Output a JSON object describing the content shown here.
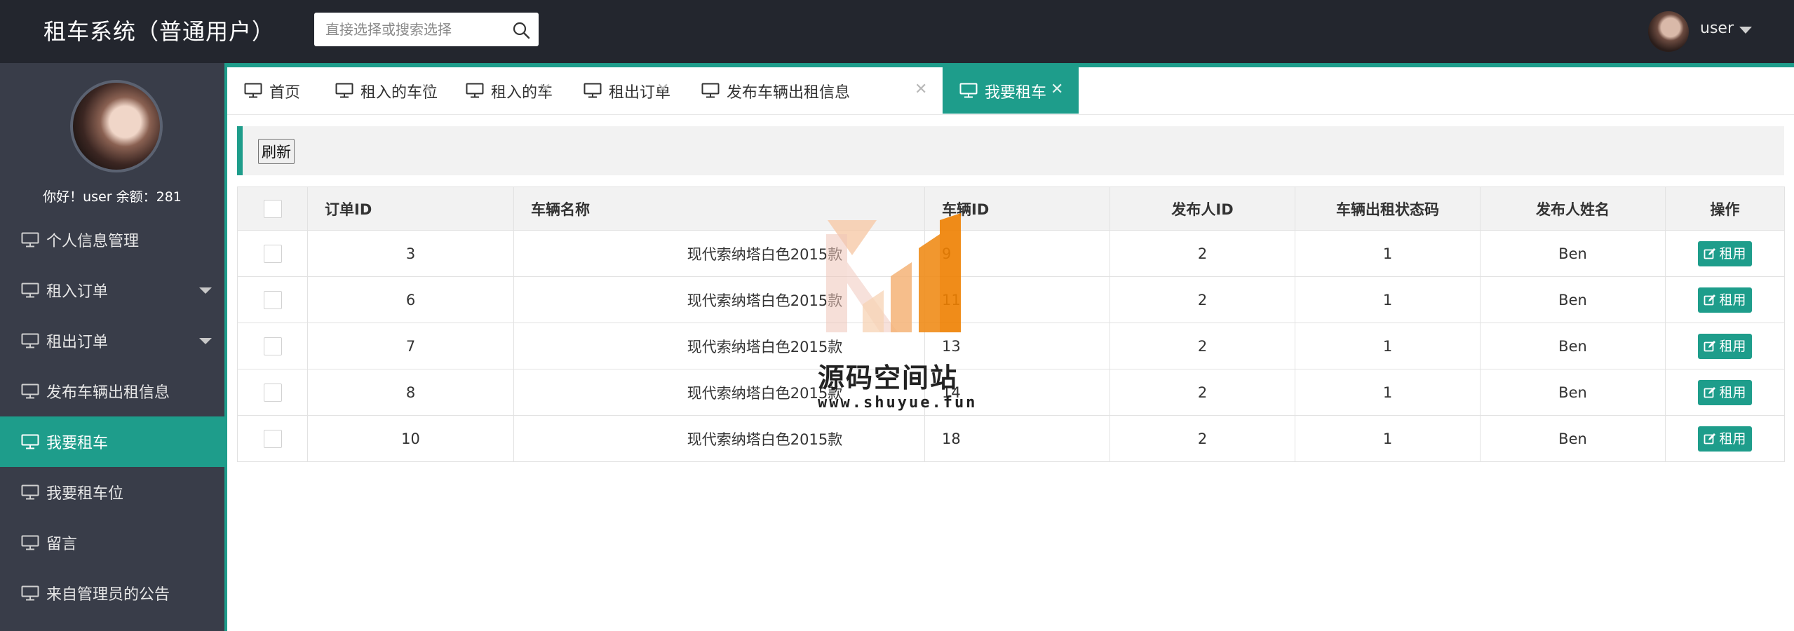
{
  "header": {
    "title": "租车系统（普通用户）",
    "search_placeholder": "直接选择或搜索选择",
    "search_icon": "search-icon",
    "username": "user"
  },
  "sidebar": {
    "greeting": "你好！user 余额：281",
    "items": [
      {
        "label": "个人信息管理",
        "icon": "monitor-icon",
        "expandable": false,
        "active": false
      },
      {
        "label": "租入订单",
        "icon": "monitor-icon",
        "expandable": true,
        "active": false
      },
      {
        "label": "租出订单",
        "icon": "monitor-icon",
        "expandable": true,
        "active": false
      },
      {
        "label": "发布车辆出租信息",
        "icon": "monitor-icon",
        "expandable": false,
        "active": false
      },
      {
        "label": "我要租车",
        "icon": "monitor-icon",
        "expandable": false,
        "active": true
      },
      {
        "label": "我要租车位",
        "icon": "monitor-icon",
        "expandable": false,
        "active": false
      },
      {
        "label": "留言",
        "icon": "monitor-icon",
        "expandable": false,
        "active": false
      },
      {
        "label": "来自管理员的公告",
        "icon": "monitor-icon",
        "expandable": false,
        "active": false
      }
    ]
  },
  "tabs": [
    {
      "label": "首页",
      "closable": false,
      "active": false
    },
    {
      "label": "租入的车位",
      "closable": true,
      "active": false
    },
    {
      "label": "租入的车",
      "closable": true,
      "active": false
    },
    {
      "label": "租出订单",
      "closable": true,
      "active": false
    },
    {
      "label": "发布车辆出租信息",
      "closable": true,
      "active": false
    },
    {
      "label": "我要租车",
      "closable": true,
      "active": true
    }
  ],
  "tab_close_glyph": "✕",
  "toolbar": {
    "refresh_label": "刷新"
  },
  "table": {
    "columns": [
      "订单ID",
      "车辆名称",
      "车辆ID",
      "发布人ID",
      "车辆出租状态码",
      "发布人姓名",
      "操作"
    ],
    "action_label": "租用",
    "rows": [
      {
        "order_id": "3",
        "car_name": "现代索纳塔白色2015款",
        "car_id": "9",
        "publisher_id": "2",
        "status_code": "1",
        "publisher_name": "Ben"
      },
      {
        "order_id": "6",
        "car_name": "现代索纳塔白色2015款",
        "car_id": "11",
        "publisher_id": "2",
        "status_code": "1",
        "publisher_name": "Ben"
      },
      {
        "order_id": "7",
        "car_name": "现代索纳塔白色2015款",
        "car_id": "13",
        "publisher_id": "2",
        "status_code": "1",
        "publisher_name": "Ben"
      },
      {
        "order_id": "8",
        "car_name": "现代索纳塔白色2015款",
        "car_id": "14",
        "publisher_id": "2",
        "status_code": "1",
        "publisher_name": "Ben"
      },
      {
        "order_id": "10",
        "car_name": "现代索纳塔白色2015款",
        "car_id": "18",
        "publisher_id": "2",
        "status_code": "1",
        "publisher_name": "Ben"
      }
    ]
  },
  "watermark": {
    "text_cn": "源码空间站",
    "text_url": "www.shuyue.fun"
  },
  "colors": {
    "accent": "#1e9d8b",
    "header_bg": "#23262e",
    "sidebar_bg": "#393d49"
  }
}
